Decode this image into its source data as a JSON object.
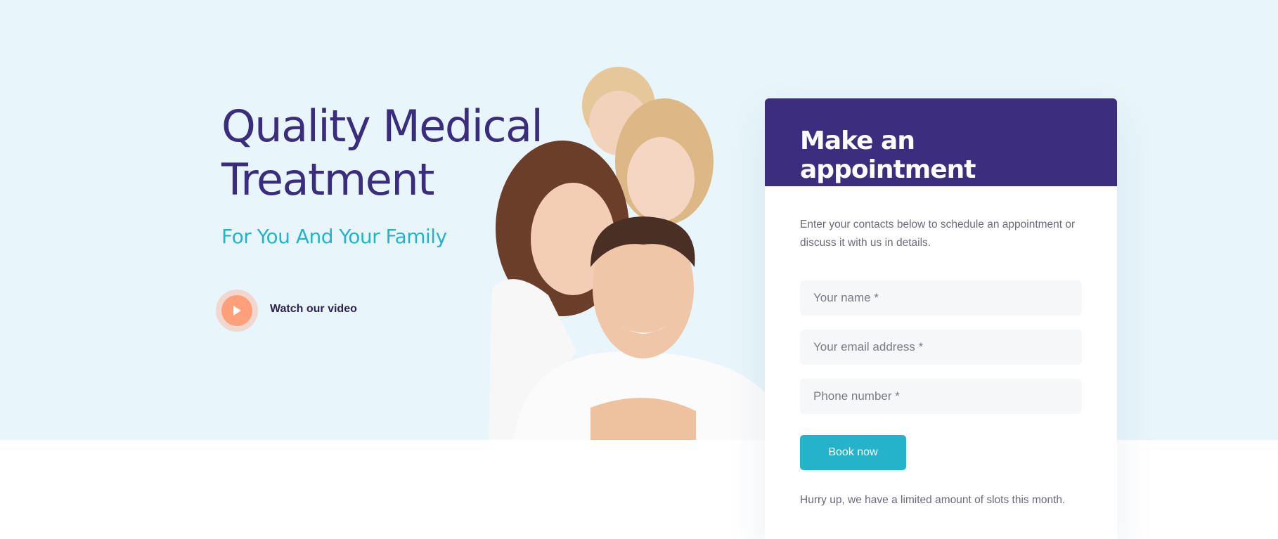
{
  "hero": {
    "title": "Quality Medical Treatment",
    "subtitle": "For You And Your Family",
    "video_link_label": "Watch our video",
    "image_alt": "Smiling family"
  },
  "appointment": {
    "title": "Make an appointment",
    "description": "Enter your contacts below to schedule an appointment or discuss it with us in details.",
    "fields": [
      {
        "placeholder": "Your name *",
        "value": ""
      },
      {
        "placeholder": "Your email address *",
        "value": ""
      },
      {
        "placeholder": "Phone number *",
        "value": ""
      }
    ],
    "submit_label": "Book now",
    "note": "Hurry up, we have a limited amount of slots this month."
  },
  "colors": {
    "hero_background": "#e8f6fb",
    "primary_purple": "#3d2d7e",
    "accent_teal": "#25b3cc",
    "play_orange": "#ffa07a"
  },
  "icons": {
    "play": "play-icon"
  }
}
